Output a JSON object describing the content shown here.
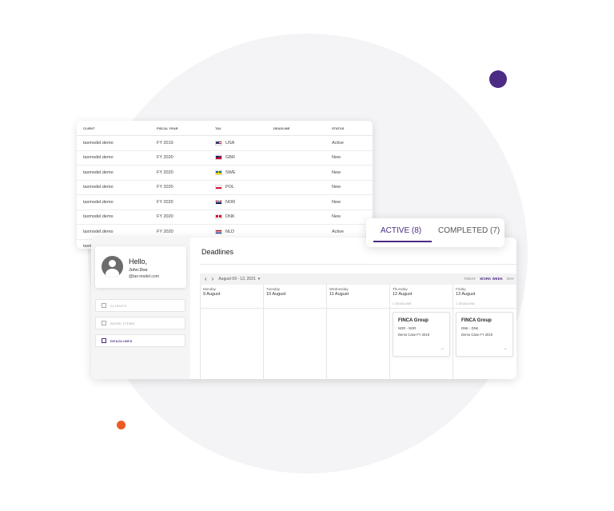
{
  "table": {
    "headers": [
      "CLIENT",
      "FISCAL YEAR",
      "TAX",
      "DEADLINE",
      "STATUS"
    ],
    "rows": [
      {
        "client": "taxmodel.demo",
        "fy": "FY 2019",
        "country": "USA",
        "status": "Active"
      },
      {
        "client": "taxmodel.demo",
        "fy": "FY 2020",
        "country": "GBR",
        "status": "New"
      },
      {
        "client": "taxmodel.demo",
        "fy": "FY 2020",
        "country": "SWE",
        "status": "New"
      },
      {
        "client": "taxmodel.demo",
        "fy": "FY 2020",
        "country": "POL",
        "status": "New"
      },
      {
        "client": "taxmodel.demo",
        "fy": "FY 2020",
        "country": "NOR",
        "status": "New"
      },
      {
        "client": "taxmodel.demo",
        "fy": "FY 2020",
        "country": "DNK",
        "status": "New"
      },
      {
        "client": "taxmodel.demo",
        "fy": "FY 2020",
        "country": "NLD",
        "status": "Active"
      },
      {
        "client": "taxm",
        "fy": "",
        "country": "",
        "status": ""
      }
    ]
  },
  "tabs": {
    "active": "ACTIVE (8)",
    "completed": "COMPLETED (7)"
  },
  "profile": {
    "greeting": "Hello,",
    "name": "John.Doe",
    "email": "@tax-model.com"
  },
  "nav": {
    "clients": "CLIENTS",
    "work_items": "WORK ITEMS",
    "deadlines": "DEADLINES"
  },
  "page": {
    "title": "Deadlines"
  },
  "toolbar": {
    "prev": "‹",
    "next": "›",
    "range": "August 09 - 13, 2021",
    "caret": "▾",
    "views": [
      "TODAY",
      "WORK WEEK",
      "DAY"
    ]
  },
  "days": [
    {
      "name": "Monday",
      "date": "9 August",
      "count": ""
    },
    {
      "name": "Tuesday",
      "date": "10 August",
      "count": ""
    },
    {
      "name": "Wednesday",
      "date": "11 August",
      "count": ""
    },
    {
      "name": "Thursday",
      "date": "12 August",
      "count": "1 DEADLINE"
    },
    {
      "name": "Friday",
      "date": "13 August",
      "count": "1 DEADLINE"
    }
  ],
  "events": {
    "thursday": {
      "title": "FINCA Group",
      "code": "NOR - NOR",
      "case": "Demo Case FY 2019",
      "arrow": "→"
    },
    "friday": {
      "title": "FINCA Group",
      "code": "DNK - DNK",
      "case": "Demo Case FY 2019",
      "arrow": "→"
    }
  },
  "colors": {
    "accent": "#4b2b83",
    "orange_dot": "#ee5a24",
    "background_circle": "#f4f3f5"
  }
}
